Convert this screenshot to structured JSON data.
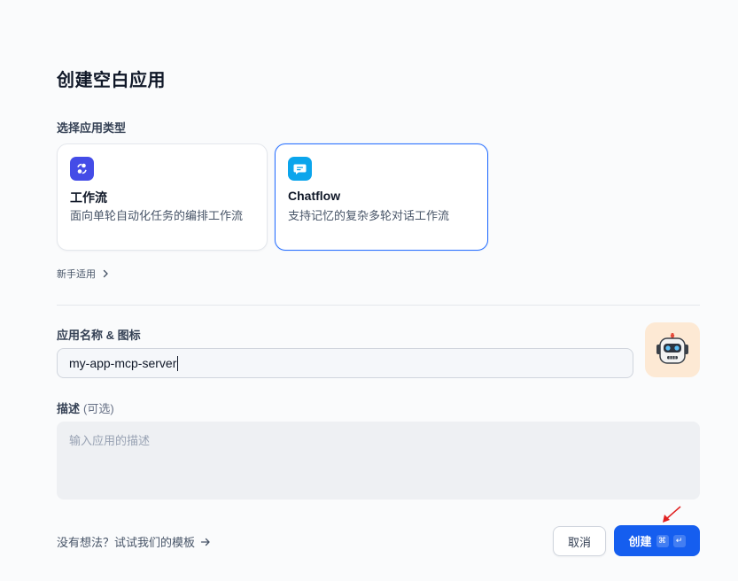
{
  "dialog": {
    "title": "创建空白应用",
    "app_type_label": "选择应用类型",
    "types": [
      {
        "name": "工作流",
        "description": "面向单轮自动化任务的编排工作流",
        "icon": "workflow-icon",
        "color": "#444ce7",
        "selected": false
      },
      {
        "name": "Chatflow",
        "description": "支持记忆的复杂多轮对话工作流",
        "icon": "chat-icon",
        "color": "#0ba5ec",
        "selected": true
      }
    ],
    "beginner_link": "新手适用",
    "name_label": "应用名称 & 图标",
    "name_value": "my-app-mcp-server",
    "avatar_icon": "robot-emoji",
    "desc_label": "描述",
    "desc_optional": "(可选)",
    "desc_placeholder": "输入应用的描述",
    "template_link": "没有想法？试试我们的模板",
    "cancel_label": "取消",
    "create_label": "创建",
    "shortcut_keys": [
      "⌘",
      "↵"
    ],
    "accent_color": "#155eef"
  }
}
